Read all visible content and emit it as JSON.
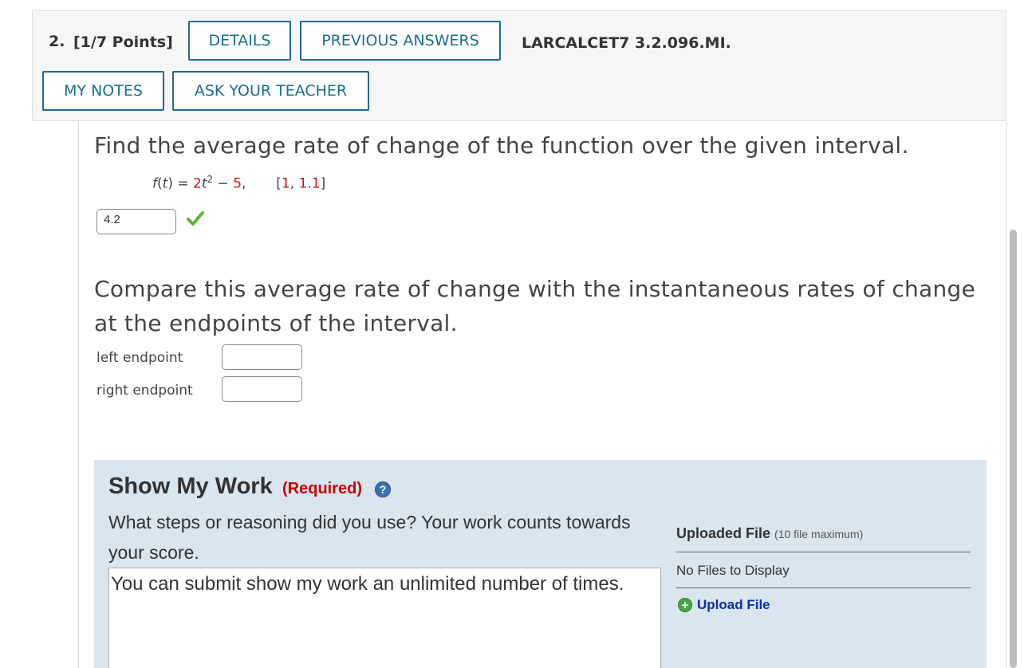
{
  "header": {
    "question_number": "2.",
    "points": "[1/7 Points]",
    "details_label": "DETAILS",
    "previous_answers_label": "PREVIOUS ANSWERS",
    "problem_code": "LARCALCET7 3.2.096.MI.",
    "my_notes_label": "MY NOTES",
    "ask_teacher_label": "ASK YOUR TEACHER"
  },
  "question": {
    "prompt": "Find the average rate of change of the function over the given interval.",
    "formula": {
      "fname": "f",
      "var": "t",
      "coef": "2",
      "exponent": "2",
      "constant": "5",
      "interval_start": "1",
      "interval_end": "1.1"
    },
    "answer_value": "4.2",
    "answer_status": "correct",
    "compare_prompt_line1": "Compare this average rate of change with the instantaneous rates of change",
    "compare_prompt_line2": "at the endpoints of the interval.",
    "left_endpoint_label": "left endpoint",
    "right_endpoint_label": "right endpoint",
    "left_endpoint_value": "",
    "right_endpoint_value": ""
  },
  "show_my_work": {
    "title": "Show My Work",
    "required_label": "(Required)",
    "help_icon": "question-circle-icon",
    "description": "What steps or reasoning did you use? Your work counts towards your score.",
    "textarea_text": "You can submit show my work an unlimited number of times.",
    "uploaded_file_label": "Uploaded File",
    "uploaded_file_limit": "(10 file maximum)",
    "no_files_text": "No Files to Display",
    "upload_label": "Upload File",
    "upload_icon": "plus-circle-icon"
  },
  "colors": {
    "accent": "#1a6d91",
    "required_red": "#cc0000",
    "panel_bg": "#d9e5ef",
    "check_green": "#5cb33a",
    "link_blue": "#0a2fa3"
  }
}
